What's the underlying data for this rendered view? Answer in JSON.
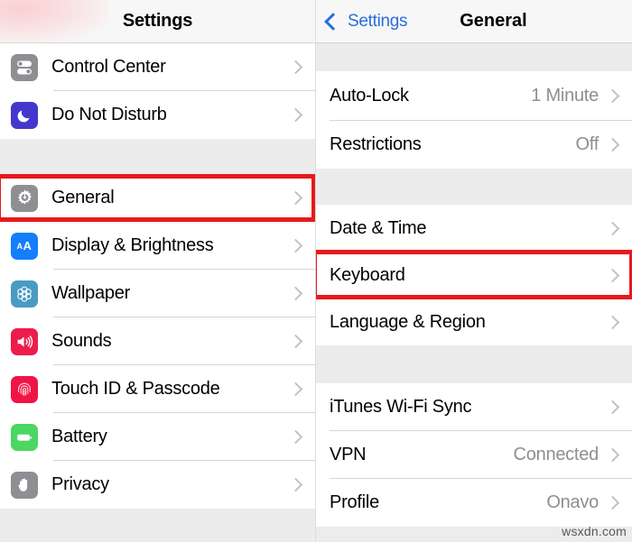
{
  "left_panel": {
    "navbar": {
      "title": "Settings"
    },
    "groups": [
      {
        "rows": [
          {
            "label": "Control Center",
            "icon": "control-center-icon",
            "icon_class": "ic-control"
          },
          {
            "label": "Do Not Disturb",
            "icon": "moon-icon",
            "icon_class": "ic-dnd"
          }
        ]
      },
      {
        "rows": [
          {
            "label": "General",
            "icon": "gear-icon",
            "icon_class": "ic-general",
            "highlighted": true
          },
          {
            "label": "Display & Brightness",
            "icon": "text-size-icon",
            "icon_class": "ic-display"
          },
          {
            "label": "Wallpaper",
            "icon": "flower-icon",
            "icon_class": "ic-wallpaper"
          },
          {
            "label": "Sounds",
            "icon": "speaker-icon",
            "icon_class": "ic-sounds"
          },
          {
            "label": "Touch ID & Passcode",
            "icon": "fingerprint-icon",
            "icon_class": "ic-touchid"
          },
          {
            "label": "Battery",
            "icon": "battery-icon",
            "icon_class": "ic-battery"
          },
          {
            "label": "Privacy",
            "icon": "hand-icon",
            "icon_class": "ic-privacy"
          }
        ]
      }
    ]
  },
  "right_panel": {
    "navbar": {
      "back_label": "Settings",
      "title": "General"
    },
    "groups": [
      {
        "rows": [
          {
            "label": "Auto-Lock",
            "value": "1 Minute"
          },
          {
            "label": "Restrictions",
            "value": "Off"
          }
        ]
      },
      {
        "rows": [
          {
            "label": "Date & Time",
            "value": ""
          },
          {
            "label": "Keyboard",
            "value": "",
            "highlighted": true
          },
          {
            "label": "Language & Region",
            "value": ""
          }
        ]
      },
      {
        "rows": [
          {
            "label": "iTunes Wi-Fi Sync",
            "value": ""
          },
          {
            "label": "VPN",
            "value": "Connected"
          },
          {
            "label": "Profile",
            "value": "Onavo"
          }
        ]
      }
    ]
  },
  "annotations": {
    "highlight_color": "#e8191b",
    "boxes": [
      {
        "name": "general-highlight",
        "target": "General"
      },
      {
        "name": "keyboard-highlight",
        "target": "Keyboard"
      }
    ]
  },
  "watermark": {
    "text": "wsxdn.com"
  }
}
